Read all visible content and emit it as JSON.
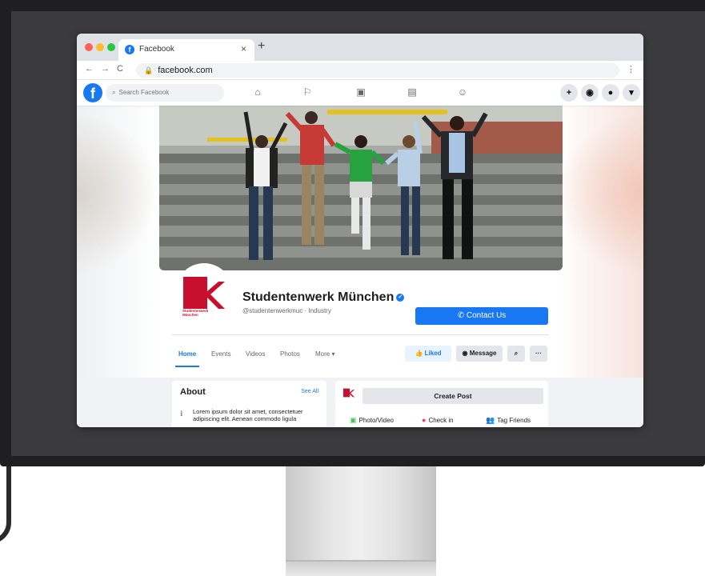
{
  "browser": {
    "tab_title": "Facebook",
    "tab_close": "×",
    "new_tab": "+",
    "url": "facebook.com",
    "back": "←",
    "forward": "→",
    "reload": "C",
    "menu": "⋮"
  },
  "fb_nav": {
    "logo": "f",
    "search_placeholder": "Search Facebook",
    "icons": [
      "home-icon",
      "flag-icon",
      "watch-icon",
      "marketplace-icon",
      "groups-icon"
    ],
    "right_buttons": [
      "+",
      "◉",
      "●",
      "▾"
    ]
  },
  "page": {
    "name": "Studentenwerk München",
    "verified_mark": "✓",
    "handle": "@studentenwerkmuc · Industry",
    "contact_button": "✆ Contact Us",
    "logo_text_line1": "Studentenwerk",
    "logo_text_line2": "München",
    "brand_color": "#c8102e"
  },
  "tabs": [
    "Home",
    "Events",
    "Videos",
    "Photos",
    "More ▾"
  ],
  "actions": {
    "liked": "👍 Liked",
    "message": "◉ Message",
    "search": "⌕",
    "more": "···"
  },
  "about": {
    "title": "About",
    "see_all": "See All",
    "text": "Lorem ipsum dolor sit amet, consectetuer adipiscing elit. Aenean commodo ligula"
  },
  "create_post": {
    "button": "Create Post",
    "options": [
      "Photo/Video",
      "Check in",
      "Tag Friends"
    ]
  },
  "colors": {
    "facebook_blue": "#1877f2",
    "background": "#f0f2f5"
  }
}
